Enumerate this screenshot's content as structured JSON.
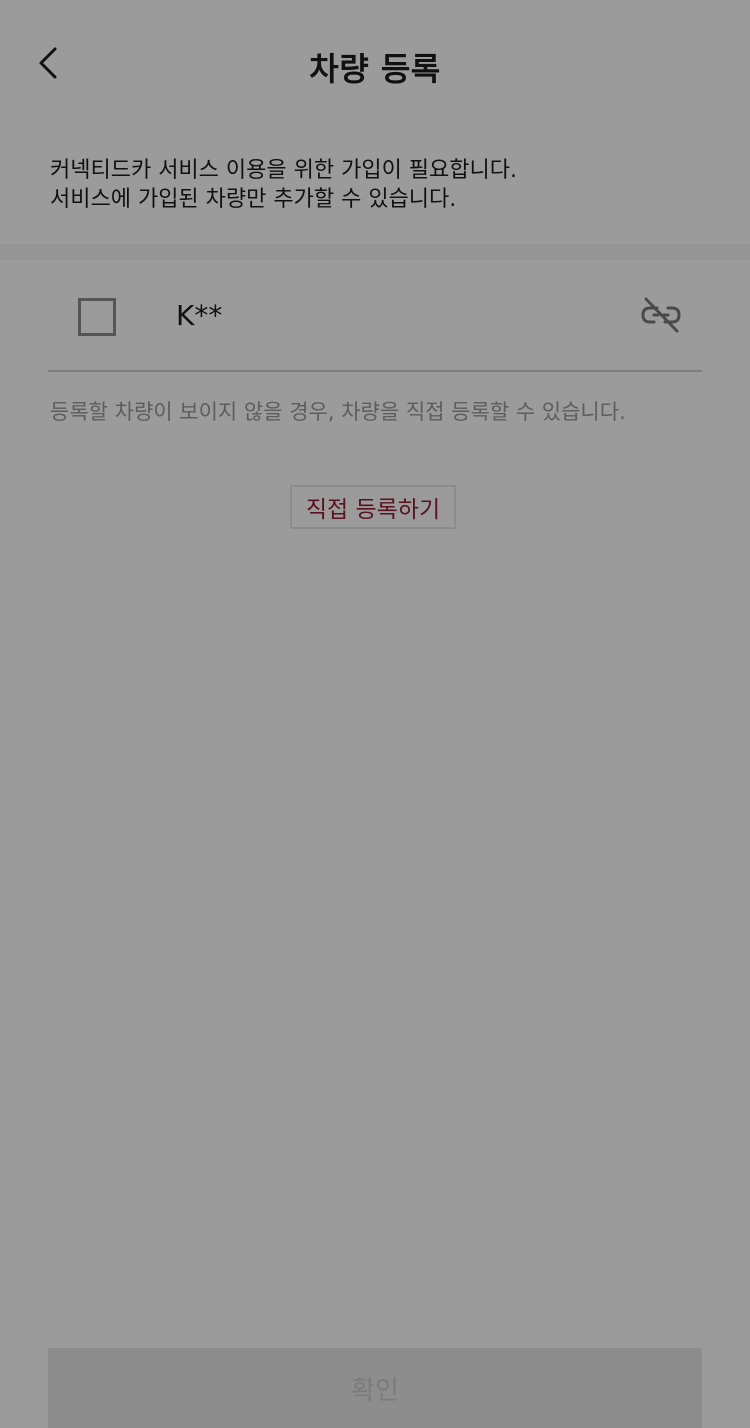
{
  "header": {
    "back_icon": "chevron-left-icon",
    "title": "차량 등록"
  },
  "intro": {
    "line1": "커넥티드카 서비스 이용을 위한 가입이 필요합니다.",
    "line2": "서비스에 가입된 차량만 추가할 수 있습니다."
  },
  "vehicles": [
    {
      "name": "K**",
      "checked": false,
      "status_icon": "unlinked-icon"
    }
  ],
  "help": {
    "text": "등록할 차량이 보이지 않을 경우, 차량을 직접 등록할 수 있습니다."
  },
  "actions": {
    "direct_register_label": "직접 등록하기",
    "confirm_label": "확인"
  },
  "colors": {
    "background": "#9b9b9b",
    "accent": "#5a1220",
    "disabled_button": "#8d8d8d"
  }
}
